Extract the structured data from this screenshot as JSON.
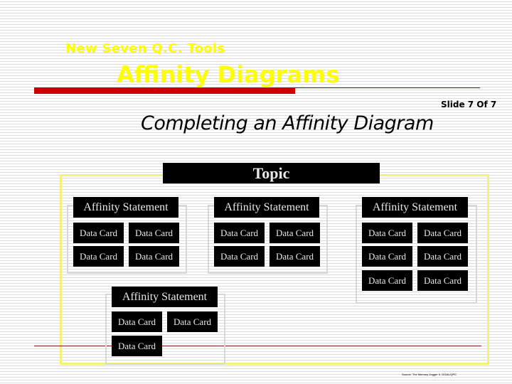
{
  "header": {
    "supertitle": "New Seven Q.C. Tools",
    "title": "Affinity Diagrams",
    "slide_number": "Slide 7 Of 7",
    "subtitle": "Completing an Affinity Diagram"
  },
  "colors": {
    "title_yellow": "#ffff00",
    "accent_red": "#cc0000",
    "frame_yellow": "#f5f07a",
    "card_black": "#000000",
    "card_text": "#e8e8e8"
  },
  "diagram": {
    "topic": "Topic",
    "groups": [
      {
        "statement": "Affinity Statement",
        "cards": [
          "Data Card",
          "Data Card",
          "Data Card",
          "Data Card"
        ]
      },
      {
        "statement": "Affinity Statement",
        "cards": [
          "Data Card",
          "Data Card",
          "Data Card",
          "Data Card"
        ]
      },
      {
        "statement": "Affinity Statement",
        "cards": [
          "Data Card",
          "Data Card",
          "Data Card",
          "Data Card",
          "Data Card",
          "Data Card"
        ]
      },
      {
        "statement": "Affinity Statement",
        "cards": [
          "Data Card",
          "Data Card",
          "Data Card"
        ]
      }
    ]
  },
  "footer": {
    "source_note": "Source: The Memory Jogger II, GOAL/QPC"
  }
}
